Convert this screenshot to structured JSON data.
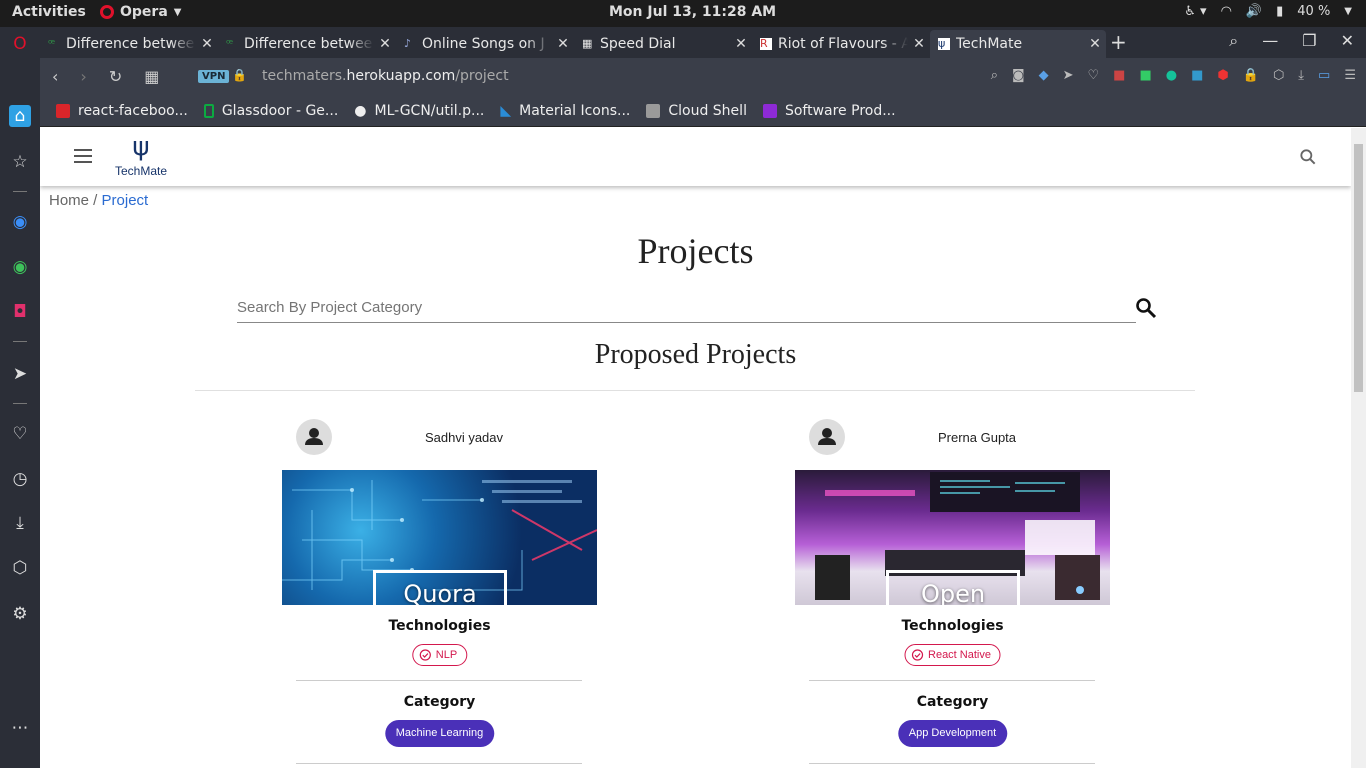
{
  "os": {
    "activities": "Activities",
    "app_menu": "Opera",
    "clock": "Mon Jul 13, 11:28 AM",
    "battery": "40 %"
  },
  "tabs": [
    {
      "title": "Difference betwee",
      "favicon": "gfg-icon"
    },
    {
      "title": "Difference betwee",
      "favicon": "gfg-icon"
    },
    {
      "title": "Online Songs on J",
      "favicon": "music-icon"
    },
    {
      "title": "Speed Dial",
      "favicon": "grid-icon"
    },
    {
      "title": "Riot of Flavours - A",
      "favicon": "riot-icon"
    },
    {
      "title": "TechMate",
      "favicon": "techmate-icon",
      "active": true
    }
  ],
  "address": {
    "vpn": "VPN",
    "url_prefix": "techmaters.",
    "url_domain": "herokuapp.com",
    "url_path": "/project"
  },
  "bookmarks": [
    {
      "label": "react-faceboo...",
      "color": "#d9252a"
    },
    {
      "label": "Glassdoor - Ge...",
      "color": "#0caa41"
    },
    {
      "label": "ML-GCN/util.p...",
      "color": "#ffffff"
    },
    {
      "label": "Material Icons...",
      "color": "#2a8cd6"
    },
    {
      "label": "Cloud Shell",
      "color": "#9a9a9a"
    },
    {
      "label": "Software Prod...",
      "color": "#8e2ad6"
    }
  ],
  "site": {
    "logo_name": "TechMate",
    "breadcrumb": {
      "home": "Home",
      "sep": " / ",
      "current": "Project"
    },
    "title": "Projects",
    "search_placeholder": "Search By Project Category",
    "section_title": "Proposed Projects"
  },
  "projects": [
    {
      "author": "Sadhvi yadav",
      "title": "Quora Question Pairs",
      "technologies_label": "Technologies",
      "technology": "NLP",
      "category_label": "Category",
      "category": "Machine Learning"
    },
    {
      "author": "Prerna Gupta",
      "title": "Open Project",
      "technologies_label": "Technologies",
      "technology": "React Native",
      "category_label": "Category",
      "category": "App Development"
    }
  ],
  "colors": {
    "accent_link": "#2a6bd1",
    "chip_outline": "#d3184d",
    "category_chip": "#4a30b8"
  }
}
